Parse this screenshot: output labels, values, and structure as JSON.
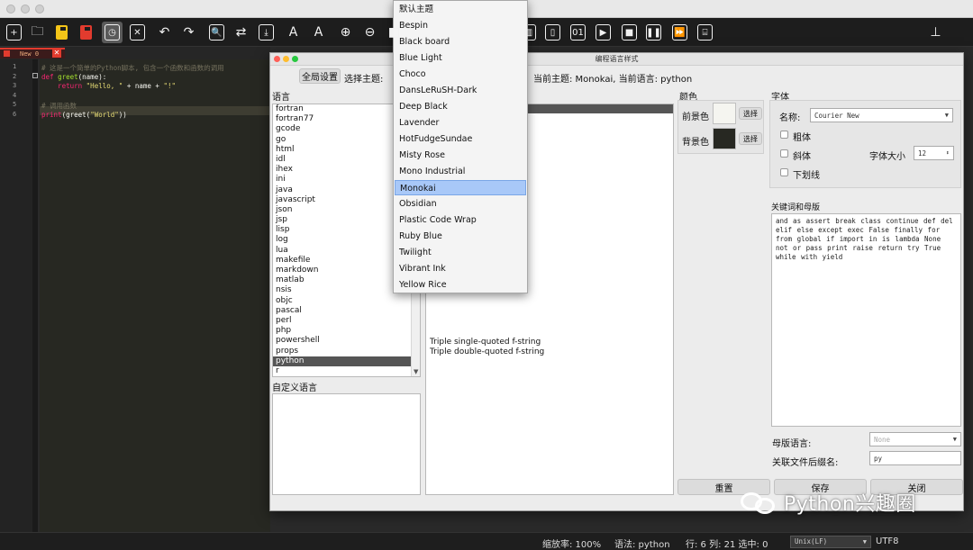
{
  "window": {
    "traffic_lights": [
      "close",
      "minimize",
      "zoom"
    ]
  },
  "toolbar": {
    "items": [
      {
        "name": "new-file-icon",
        "glyph": "+"
      },
      {
        "name": "open-folder-icon",
        "glyph": "🗀"
      },
      {
        "name": "save-icon",
        "glyph": ""
      },
      {
        "name": "save-as-icon",
        "glyph": ""
      },
      {
        "name": "clock-icon",
        "glyph": "◷"
      },
      {
        "name": "close-file-icon",
        "glyph": "✕"
      },
      {
        "name": "undo-icon",
        "glyph": "↶"
      },
      {
        "name": "redo-icon",
        "glyph": "↷"
      },
      {
        "name": "find-icon",
        "glyph": "🔍"
      },
      {
        "name": "replace-icon",
        "glyph": "⇄"
      },
      {
        "name": "goto-icon",
        "glyph": "⤓"
      },
      {
        "name": "font-increase-icon",
        "glyph": "A"
      },
      {
        "name": "font-decrease-icon",
        "glyph": "A"
      },
      {
        "name": "zoom-in-icon",
        "glyph": "⊕"
      },
      {
        "name": "zoom-out-icon",
        "glyph": "⊖"
      },
      {
        "name": "theme-icon",
        "glyph": "◧"
      },
      {
        "name": "column-icon",
        "glyph": "▥"
      },
      {
        "name": "split-icon",
        "glyph": "▯"
      },
      {
        "name": "binary-icon",
        "glyph": "01"
      },
      {
        "name": "run-icon",
        "glyph": "▶"
      },
      {
        "name": "stop-icon",
        "glyph": "■"
      },
      {
        "name": "pause-icon",
        "glyph": "❚❚"
      },
      {
        "name": "fast-forward-icon",
        "glyph": "⏩"
      },
      {
        "name": "terminal-icon",
        "glyph": "⌸"
      }
    ],
    "pin_glyph": "⊥"
  },
  "editor": {
    "tab_label": "New 0",
    "tab_close": "✕",
    "line_numbers": [
      "1",
      "2",
      "3",
      "4",
      "5",
      "6"
    ],
    "lines": [
      [
        {
          "t": "# 这是一个简单的Python脚本, 包含一个函数和函数的调用",
          "c": "com"
        }
      ],
      [
        {
          "t": "def ",
          "c": "kw"
        },
        {
          "t": "greet",
          "c": "fn"
        },
        {
          "t": "(name):",
          "c": "txt"
        }
      ],
      [
        {
          "t": "    return ",
          "c": "kw"
        },
        {
          "t": "\"Hello, \"",
          "c": "str"
        },
        {
          "t": " + name + ",
          "c": "txt"
        },
        {
          "t": "\"!\"",
          "c": "str"
        }
      ],
      [
        {
          "t": "",
          "c": "txt"
        }
      ],
      [
        {
          "t": "# 调用函数",
          "c": "com"
        }
      ],
      [
        {
          "t": "print",
          "c": "kw"
        },
        {
          "t": "(greet(",
          "c": "txt"
        },
        {
          "t": "\"World\"",
          "c": "str"
        },
        {
          "t": "))",
          "c": "txt"
        }
      ]
    ]
  },
  "dialog": {
    "title": "编程语言样式",
    "global_settings_button": "全局设置",
    "select_theme_label": "选择主题:",
    "current_info": "当前主题: Monokai, 当前语言: python",
    "language_label": "语言",
    "languages": [
      "fortran",
      "fortran77",
      "gcode",
      "go",
      "html",
      "idl",
      "ihex",
      "ini",
      "java",
      "javascript",
      "json",
      "jsp",
      "lisp",
      "log",
      "lua",
      "makefile",
      "markdown",
      "matlab",
      "nsis",
      "objc",
      "pascal",
      "perl",
      "php",
      "powershell",
      "props",
      "python",
      "r"
    ],
    "selected_language": "python",
    "custom_language_label": "自定义语言",
    "style_parts_visible": [
      "Triple single-quoted f-string",
      "Triple double-quoted f-string"
    ],
    "color_group_label": "颜色",
    "foreground_label": "前景色",
    "background_label": "背景色",
    "choose_button": "选择",
    "foreground_color": "#f5f5f0",
    "background_color": "#272822",
    "font_group_label": "字体",
    "font_name_label": "名称:",
    "font_name_value": "Courier New",
    "bold_label": "粗体",
    "italic_label": "斜体",
    "underline_label": "下划线",
    "font_size_label": "字体大小",
    "font_size_value": "12",
    "keywords_label": "关键词和母版",
    "keywords_text": "and as assert break class continue def del elif else except exec False finally for from global if import in is lambda None not or pass print raise return try True while with yield",
    "master_language_label": "母版语言:",
    "master_language_value": "None",
    "file_ext_label": "关联文件后缀名:",
    "file_ext_value": "py",
    "reset_button": "重置",
    "save_button": "保存",
    "close_button": "关闭"
  },
  "theme_dropdown": {
    "options": [
      "默认主题",
      "Bespin",
      "Black board",
      "Blue Light",
      "Choco",
      "DansLeRuSH-Dark",
      "Deep Black",
      "Lavender",
      "HotFudgeSundae",
      "Misty Rose",
      "Mono Industrial",
      "Monokai",
      "Obsidian",
      "Plastic Code Wrap",
      "Ruby Blue",
      "Twilight",
      "Vibrant Ink",
      "Yellow Rice"
    ],
    "selected": "Monokai"
  },
  "status_bar": {
    "zoom": "缩放率: 100%",
    "syntax": "语法: python",
    "position": "行: 6 列: 21 选中: 0",
    "line_ending": "Unix(LF)",
    "encoding": "UTF8"
  },
  "watermark": {
    "text": "Python兴趣圈"
  },
  "colors": {
    "accent_red": "#e23b2e",
    "accent_yellow": "#f5c518",
    "selection_blue": "#a8c8f8",
    "editor_bg": "#272822"
  }
}
